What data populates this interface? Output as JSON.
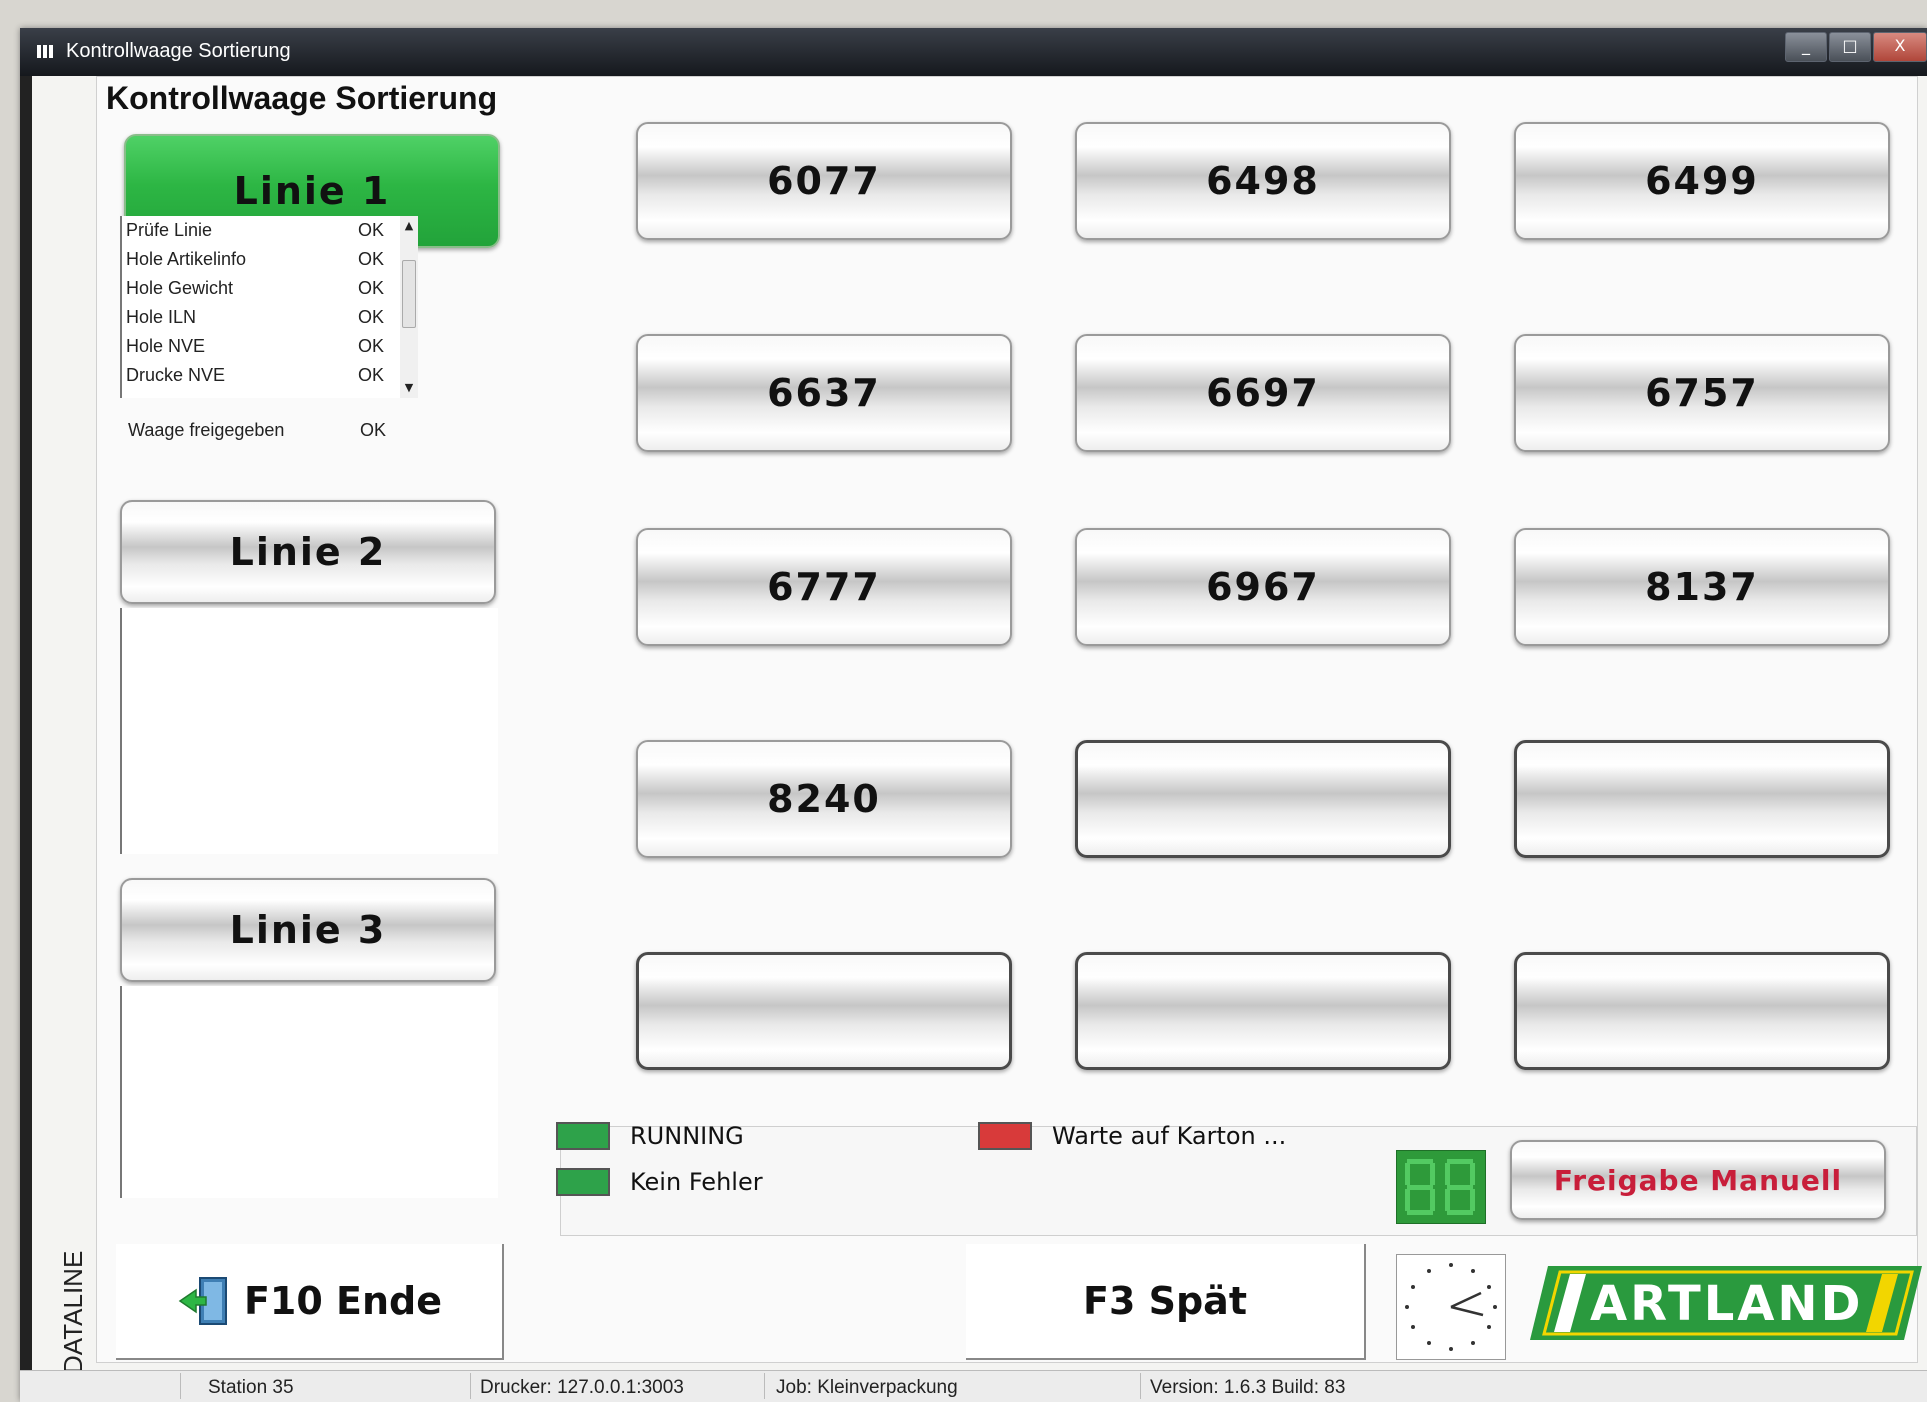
{
  "window": {
    "title": "Kontrollwaage Sortierung",
    "controls": {
      "minimize": "_",
      "maximize": "□",
      "close": "X"
    }
  },
  "heading": "Kontrollwaage Sortierung",
  "lines": [
    {
      "label": "Linie 1",
      "active": true,
      "status_items": [
        {
          "name": "Prüfe Linie",
          "value": "OK"
        },
        {
          "name": "Hole Artikelinfo",
          "value": "OK"
        },
        {
          "name": "Hole Gewicht",
          "value": "OK"
        },
        {
          "name": "Hole ILN",
          "value": "OK"
        },
        {
          "name": "Hole NVE",
          "value": "OK"
        },
        {
          "name": "Drucke NVE",
          "value": "OK"
        },
        {
          "name": "Waage freigegeben",
          "value": "OK"
        }
      ]
    },
    {
      "label": "Linie 2",
      "active": false
    },
    {
      "label": "Linie 3",
      "active": false
    }
  ],
  "grid_buttons": [
    "6077",
    "6498",
    "6499",
    "6637",
    "6697",
    "6757",
    "6777",
    "6967",
    "8137",
    "8240",
    "",
    "",
    "",
    "",
    ""
  ],
  "legend": {
    "running": "RUNNING",
    "no_error": "Kein Fehler",
    "waiting": "Warte auf Karton ...",
    "manual_release": "Freigabe Manuell",
    "colors": {
      "green": "#2ea24a",
      "red": "#d83a3a"
    }
  },
  "bottom": {
    "end_button": "F10 Ende",
    "late_button": "F3 Spät",
    "logo": "ARTLAND",
    "vendor": "DATALINE"
  },
  "statusbar": {
    "station": "Station 35",
    "printer": "Drucker: 127.0.0.1:3003",
    "job": "Job: Kleinverpackung",
    "version": "Version: 1.6.3 Build: 83"
  }
}
